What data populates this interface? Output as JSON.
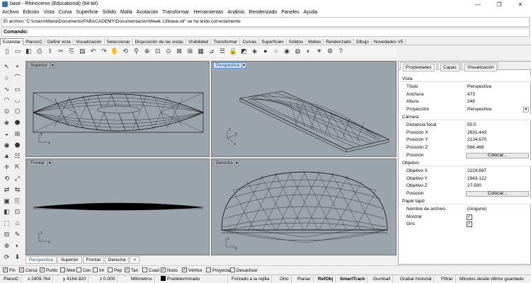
{
  "window": {
    "title": "base - Rhinoceros (Educational) (64-bit)",
    "minimize": "—",
    "maximize": "❐",
    "close": "✕"
  },
  "menu": [
    "Archivo",
    "Edición",
    "Vista",
    "Curva",
    "Superficie",
    "Sólido",
    "Malla",
    "Acotación",
    "Transformar",
    "Herramientas",
    "Análisis",
    "Renderizado",
    "Paneles",
    "Ayuda"
  ],
  "command_history": "El archivo \"C:\\Users\\Maria\\Documents\\FABACADEMY\\Documentación\\Week 13\\base.stl\" se ha leído correctamente",
  "command": {
    "label": "Comando:",
    "value": ""
  },
  "toolbar_tabs": [
    "Estándar",
    "PlanosC",
    "Definir vista",
    "Visualización",
    "Seleccionar",
    "Disposición de las vistas",
    "Visibilidad",
    "Transformar",
    "Curvas",
    "Superficies",
    "Sólidos",
    "Mallas",
    "Renderizado",
    "Dibujo",
    "Novedades V5"
  ],
  "toolbar_icons": [
    "new-file-icon",
    "open-icon",
    "save-icon",
    "print-icon",
    "import-icon",
    "cut-icon",
    "copy-icon",
    "paste-icon",
    "undo-icon",
    "redo-icon",
    "pan-icon",
    "rotate-view-icon",
    "zoom-icon",
    "zoom-window-icon",
    "zoom-extents-icon",
    "zoom-selected-icon",
    "zoom-all-icon",
    "four-viewports-icon",
    "grid-icon",
    "cplane-icon",
    "layer-icon",
    "lock-icon",
    "properties-icon",
    "material-icon",
    "render-sphere-icon",
    "wire-sphere-icon",
    "shaded-sphere-icon",
    "rendered-sphere-icon",
    "ghosted-sphere-icon",
    "light-icon",
    "tools-icon",
    "help-icon"
  ],
  "toolbar_glyphs": [
    "▯",
    "▭",
    "◧",
    "⎙",
    "⇪",
    "✂",
    "⎘",
    "▤",
    "↶",
    "↷",
    "✋",
    "⟲",
    "⚲",
    "⊕",
    "⊡",
    "⊙",
    "⊠",
    "⊞",
    "▦",
    "⊿",
    "☰",
    "🔒",
    "◩",
    "◈",
    "●",
    "○",
    "◉",
    "◍",
    "◐",
    "☀",
    "⚙",
    "?"
  ],
  "left_tools": [
    "↖",
    "•",
    "○",
    "⌒",
    "∿",
    "▭",
    "◠",
    "◡",
    "⊙",
    "⬡",
    "◈",
    "⬢",
    "◒",
    "⊞",
    "◉",
    "⬣",
    "▲",
    "☷",
    "✛",
    "⇱",
    "⟲",
    "⤢",
    "⇄",
    "⇆",
    "▣",
    "⎘",
    "◧",
    "⊡",
    "⬚",
    "⌂",
    "⊟",
    "✎",
    "⊕",
    "◐",
    "⟳",
    "⬇"
  ],
  "viewports": {
    "top": {
      "title": "Superior"
    },
    "perspective": {
      "title": "Perspectiva"
    },
    "front": {
      "title": "Frontal"
    },
    "right": {
      "title": "Derecha"
    }
  },
  "axes": {
    "x": "x",
    "y": "y",
    "z": "z"
  },
  "viewport_tabs": [
    "Perspectiva",
    "Superior",
    "Frontal",
    "Derecha",
    "+"
  ],
  "osnaps": [
    {
      "label": "Fin",
      "checked": true
    },
    {
      "label": "Cerca",
      "checked": true
    },
    {
      "label": "Punto",
      "checked": true
    },
    {
      "label": "Med",
      "checked": false
    },
    {
      "label": "Cen",
      "checked": false
    },
    {
      "label": "Int",
      "checked": false
    },
    {
      "label": "Pep",
      "checked": false
    },
    {
      "label": "Tan",
      "checked": true
    },
    {
      "label": "Cuad",
      "checked": false
    },
    {
      "label": "Nodo",
      "checked": true
    },
    {
      "label": "Vértice",
      "checked": true
    },
    {
      "label": "Proyectar",
      "checked": false
    },
    {
      "label": "Desactivar",
      "checked": false
    }
  ],
  "status": {
    "cplane": "PlanoC",
    "x": "x 2409.764",
    "y": "y 4164.920",
    "z": "z 0.000",
    "units": "Milímetros",
    "layer": "Predeterminado",
    "snap_grid": "Forzado a la rejilla",
    "ortho": "Orto",
    "planar": "Planar",
    "osnap": "RefObj",
    "smarttrack": "SmartTrack",
    "gumball": "Gumball",
    "history": "Grabar historial",
    "filter": "Filtrar",
    "minutes": "Minutos desde último guardado"
  },
  "panel": {
    "tabs": [
      "Propiedades",
      "Capas",
      "Visualización"
    ],
    "sections": {
      "view": "Vista",
      "camera": "Cámara",
      "target": "Objetivo",
      "wallpaper": "Papel tapiz"
    },
    "view_rows": [
      {
        "k": "Título",
        "v": "Perspectiva"
      },
      {
        "k": "Anchura",
        "v": "473"
      },
      {
        "k": "Altura",
        "v": "249"
      },
      {
        "k": "Proyección",
        "v": "Perspectiva"
      }
    ],
    "camera_rows": [
      {
        "k": "Distancia focal",
        "v": "50.0"
      },
      {
        "k": "Posición X",
        "v": "2631.443"
      },
      {
        "k": "Posición Y",
        "v": "2134.670"
      },
      {
        "k": "Posición Z",
        "v": "566.468"
      },
      {
        "k": "Posición",
        "v": "Colocar..."
      }
    ],
    "target_rows": [
      {
        "k": "Objetivo X",
        "v": "2224.697"
      },
      {
        "k": "Objetivo Y",
        "v": "2943.122"
      },
      {
        "k": "Objetivo Z",
        "v": "27.500"
      },
      {
        "k": "Posición",
        "v": "Colocar..."
      }
    ],
    "wallpaper_rows": [
      {
        "k": "Nombre de archivo",
        "v": "(ninguno)"
      },
      {
        "k": "Mostrar",
        "v": "✓"
      },
      {
        "k": "Gris",
        "v": "✓"
      }
    ]
  },
  "colors": {
    "viewport_bg": "#9ba4ab",
    "active_viewport": "#5b8fcf",
    "mesh": "#000000"
  }
}
